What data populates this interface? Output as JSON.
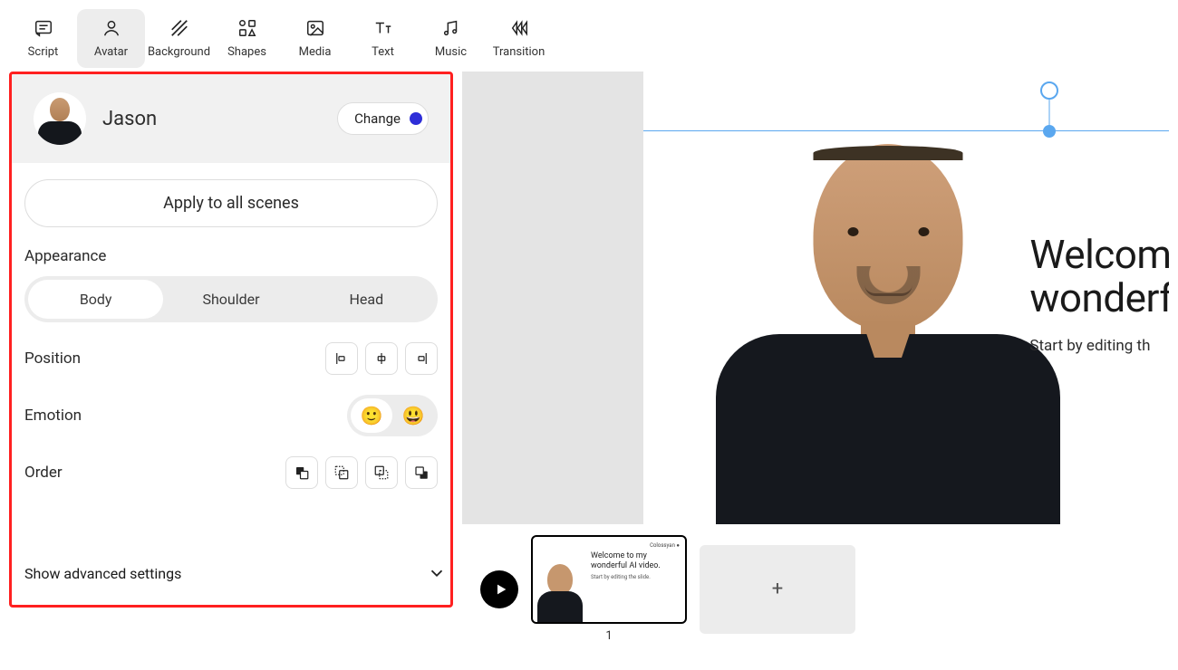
{
  "toolbar": {
    "tabs": [
      {
        "label": "Script"
      },
      {
        "label": "Avatar",
        "active": true
      },
      {
        "label": "Background"
      },
      {
        "label": "Shapes"
      },
      {
        "label": "Media"
      },
      {
        "label": "Text"
      },
      {
        "label": "Music"
      },
      {
        "label": "Transition"
      }
    ]
  },
  "avatar_panel": {
    "name": "Jason",
    "change_label": "Change",
    "apply_all_label": "Apply to all scenes",
    "appearance_label": "Appearance",
    "appearance_options": [
      "Body",
      "Shoulder",
      "Head"
    ],
    "appearance_selected": "Body",
    "position_label": "Position",
    "emotion_label": "Emotion",
    "emotion_options": [
      "🙂",
      "😃"
    ],
    "emotion_selected_index": 0,
    "order_label": "Order",
    "advanced_label": "Show advanced settings"
  },
  "canvas": {
    "headline_l1": "Welcom",
    "headline_l2": "wonderf",
    "subline": "Start by editing th"
  },
  "strip": {
    "thumb": {
      "title_l1": "Welcome to my",
      "title_l2": "wonderful AI video.",
      "sub": "Start by editing the slide.",
      "logo": "Colossyan ●",
      "number": "1"
    },
    "add": "+"
  }
}
